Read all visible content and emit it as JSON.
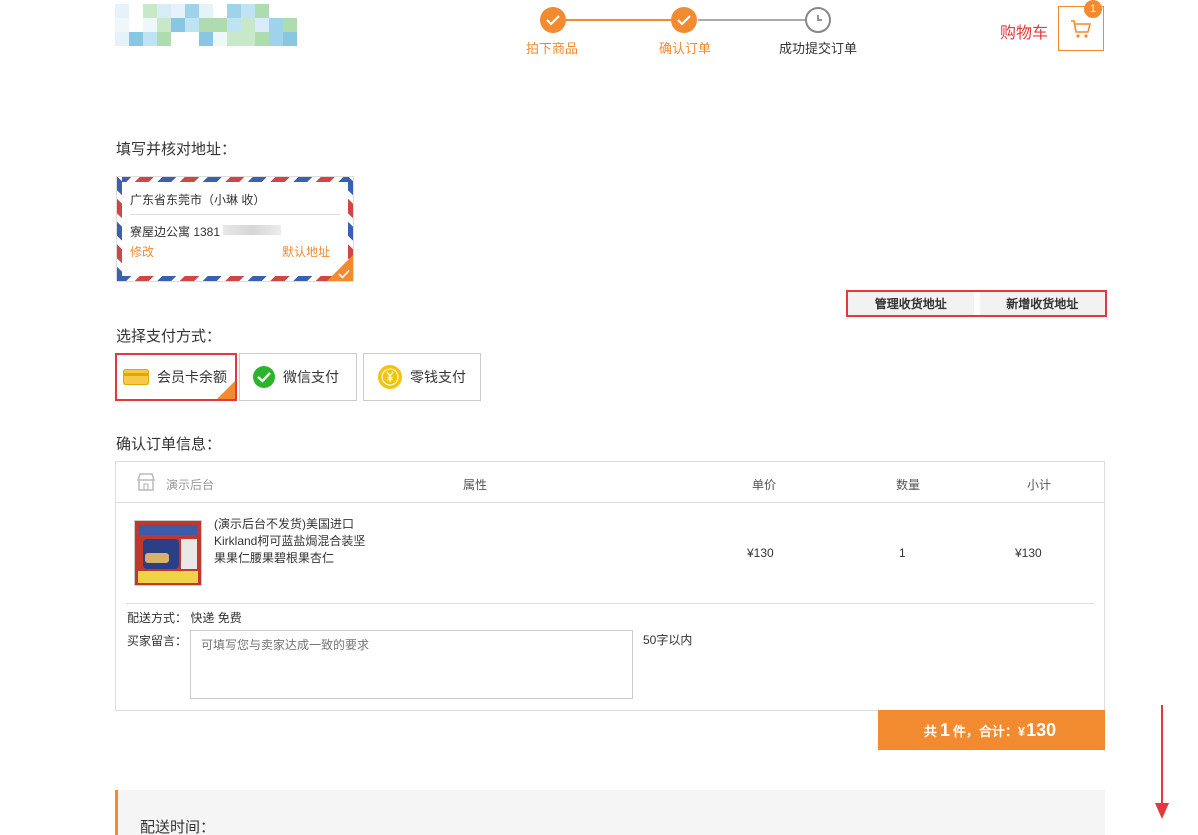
{
  "header": {
    "steps": [
      {
        "label": "拍下商品",
        "state": "done"
      },
      {
        "label": "确认订单",
        "state": "done"
      },
      {
        "label": "成功提交订单",
        "state": "todo"
      }
    ],
    "cart_label": "购物车",
    "cart_count": "1"
  },
  "address": {
    "section_title": "填写并核对地址：",
    "line1": "广东省东莞市（小琳 收）",
    "line2": "寮屋边公寓 1381",
    "edit_label": "修改",
    "default_label": "默认地址",
    "manage_button": "管理收货地址",
    "add_button": "新增收货地址"
  },
  "payment": {
    "section_title": "选择支付方式：",
    "options": [
      {
        "label": "会员卡余额",
        "icon": "card-icon",
        "selected": true
      },
      {
        "label": "微信支付",
        "icon": "wechat-icon",
        "selected": false
      },
      {
        "label": "零钱支付",
        "icon": "coin-icon",
        "selected": false
      }
    ]
  },
  "order": {
    "section_title": "确认订单信息：",
    "shop_name": "演示后台",
    "columns": {
      "attr": "属性",
      "price": "单价",
      "qty": "数量",
      "subtotal": "小计"
    },
    "item": {
      "name": "(演示后台不发货)美国进口Kirkland柯可蓝盐焗混合装坚果果仁腰果碧根果杏仁",
      "price": "¥130",
      "qty": "1",
      "subtotal": "¥130"
    },
    "shipping_label": "配送方式：",
    "shipping_value": "快递 免费",
    "message_label": "买家留言：",
    "message_placeholder": "可填写您与卖家达成一致的要求",
    "message_limit": "50字以内"
  },
  "total": {
    "prefix": "共",
    "count": "1",
    "mid": "件，合计：¥",
    "amount": "130"
  },
  "delivery": {
    "title": "配送时间："
  },
  "colors": {
    "accent": "#f28a2f",
    "highlight": "#e4393c"
  }
}
